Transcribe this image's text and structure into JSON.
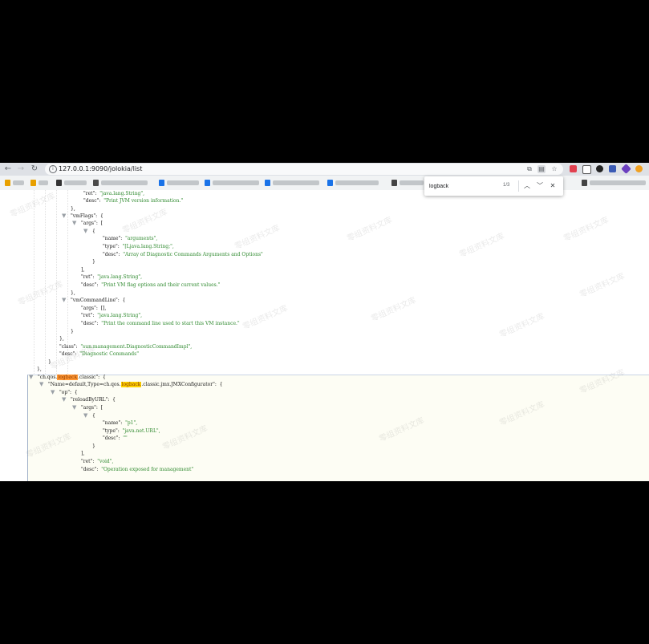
{
  "browser": {
    "url": "127.0.0.1:9090/jolokia/list",
    "colors": {
      "toolbar": "#dee1e6",
      "bookmarks_bar": "#f1f3f4",
      "highlight": "#ffd200",
      "current_highlight": "#ff9632",
      "string": "#2f8a2f"
    }
  },
  "find_bar": {
    "query": "logback",
    "count": "1/3"
  },
  "json_view": {
    "line1": {
      "key": "\"ret\":",
      "value": "\"java.lang.String\","
    },
    "line2": {
      "key": "\"desc\":",
      "value": "\"Print JVM version information.\""
    },
    "line3": {
      "text": "},"
    },
    "line4": {
      "key": "\"vmFlags\":",
      "brace": "{"
    },
    "line5": {
      "key": "\"args\":",
      "brace": "["
    },
    "line6": {
      "text": "{"
    },
    "line7": {
      "key": "\"name\":",
      "value": "\"arguments\","
    },
    "line8": {
      "key": "\"type\":",
      "value": "\"[Ljava.lang.String;\","
    },
    "line9": {
      "key": "\"desc\":",
      "value": "\"Array of Diagnostic Commands Arguments and Options\""
    },
    "line10": {
      "text": "}"
    },
    "line11": {
      "text": "],"
    },
    "line12": {
      "key": "\"ret\":",
      "value": "\"java.lang.String\","
    },
    "line13": {
      "key": "\"desc\":",
      "value": "\"Print VM flag options and their current values.\""
    },
    "line14": {
      "text": "},"
    },
    "line15": {
      "key": "\"vmCommandLine\":",
      "brace": "{"
    },
    "line16": {
      "key": "\"args\":",
      "value": "[],"
    },
    "line17": {
      "key": "\"ret\":",
      "value": "\"java.lang.String\","
    },
    "line18": {
      "key": "\"desc\":",
      "value": "\"Print the command line used to start this VM instance.\""
    },
    "line19": {
      "text": "}"
    },
    "line20": {
      "text": "},"
    },
    "line21": {
      "key": "\"class\":",
      "value": "\"sun.management.DiagnosticCommandImpl\","
    },
    "line22": {
      "key": "\"desc\":",
      "value": "\"Diagnostic Commands\""
    },
    "line23": {
      "text": "}"
    },
    "line24": {
      "text": "},"
    },
    "line25": {
      "key_pre": "\"ch.qos.",
      "key_hl": "logback",
      "key_post": ".classic\":",
      "brace": "{"
    },
    "line26": {
      "key_pre": "\"Name=default,Type=ch.qos.",
      "key_hl": "logback",
      "key_post": ".classic.jmx.JMXConfigurator\":",
      "brace": "{"
    },
    "line27": {
      "key": "\"op\":",
      "brace": "{"
    },
    "line28": {
      "key": "\"reloadByURL\":",
      "brace": "{"
    },
    "line29": {
      "key": "\"args\":",
      "brace": "["
    },
    "line30": {
      "text": "{"
    },
    "line31": {
      "key": "\"name\":",
      "value": "\"p1\","
    },
    "line32": {
      "key": "\"type\":",
      "value": "\"java.net.URL\","
    },
    "line33": {
      "key": "\"desc\":",
      "value": "\"\""
    },
    "line34": {
      "text": "}"
    },
    "line35": {
      "text": "],"
    },
    "line36": {
      "key": "\"ret\":",
      "value": "\"void\","
    },
    "line37": {
      "key": "\"desc\":",
      "value": "\"Operation exposed for management\""
    }
  },
  "watermark": "零组资料文库"
}
